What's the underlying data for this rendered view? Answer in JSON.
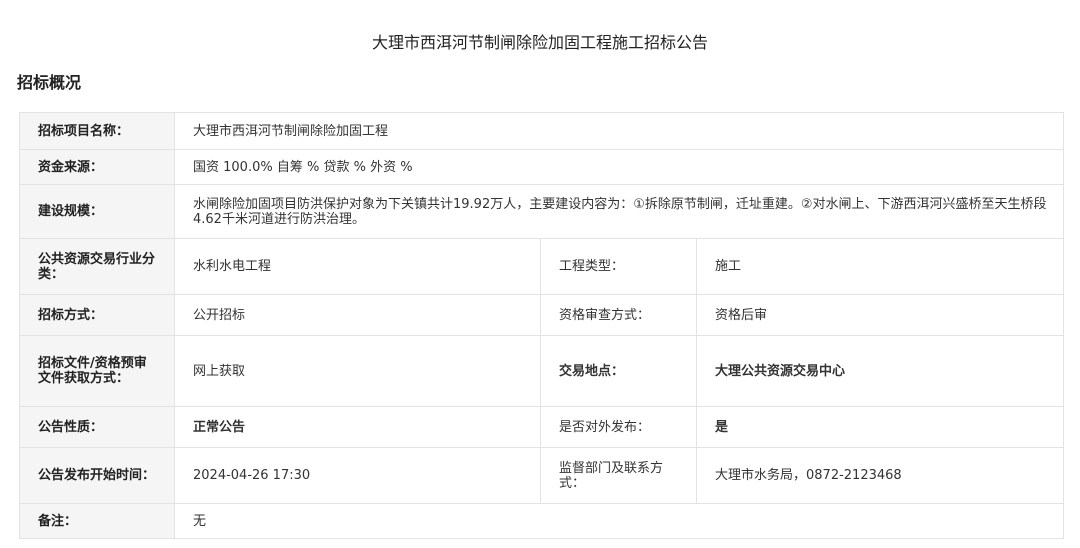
{
  "page_title": "大理市西洱河节制闸除险加固工程施工招标公告",
  "section_heading": "招标概况",
  "rows": {
    "project_name": {
      "label": "招标项目名称：",
      "value": "大理市西洱河节制闸除险加固工程"
    },
    "fund_source": {
      "label": "资金来源：",
      "value": "国资 100.0% 自筹 % 贷款 % 外资 %"
    },
    "scale": {
      "label": "建设规模：",
      "value": "水闸除险加固项目防洪保护对象为下关镇共计19.92万人，主要建设内容为：①拆除原节制闸，迁址重建。②对水闸上、下游西洱河兴盛桥至天生桥段4.62千米河道进行防洪治理。"
    },
    "industry": {
      "label": "公共资源交易行业分类：",
      "value": "水利水电工程",
      "label2": "工程类型：",
      "value2": "施工"
    },
    "method": {
      "label": "招标方式：",
      "value": "公开招标",
      "label2": "资格审查方式：",
      "value2": "资格后审"
    },
    "doc_access": {
      "label": "招标文件/资格预审文件获取方式：",
      "value": "网上获取",
      "label2": "交易地点：",
      "value2": "大理公共资源交易中心"
    },
    "nature": {
      "label": "公告性质：",
      "value": "正常公告",
      "label2": "是否对外发布：",
      "value2": "是"
    },
    "publish_time": {
      "label": "公告发布开始时间：",
      "value": "2024-04-26 17:30",
      "label2": "监督部门及联系方式：",
      "value2": "大理市水务局，0872-2123468"
    },
    "remarks": {
      "label": "备注：",
      "value": "无"
    }
  },
  "colors": {
    "label_bg": "#f5f5f5",
    "border": "#e3e3e3",
    "highlight_red": "#e60000"
  }
}
